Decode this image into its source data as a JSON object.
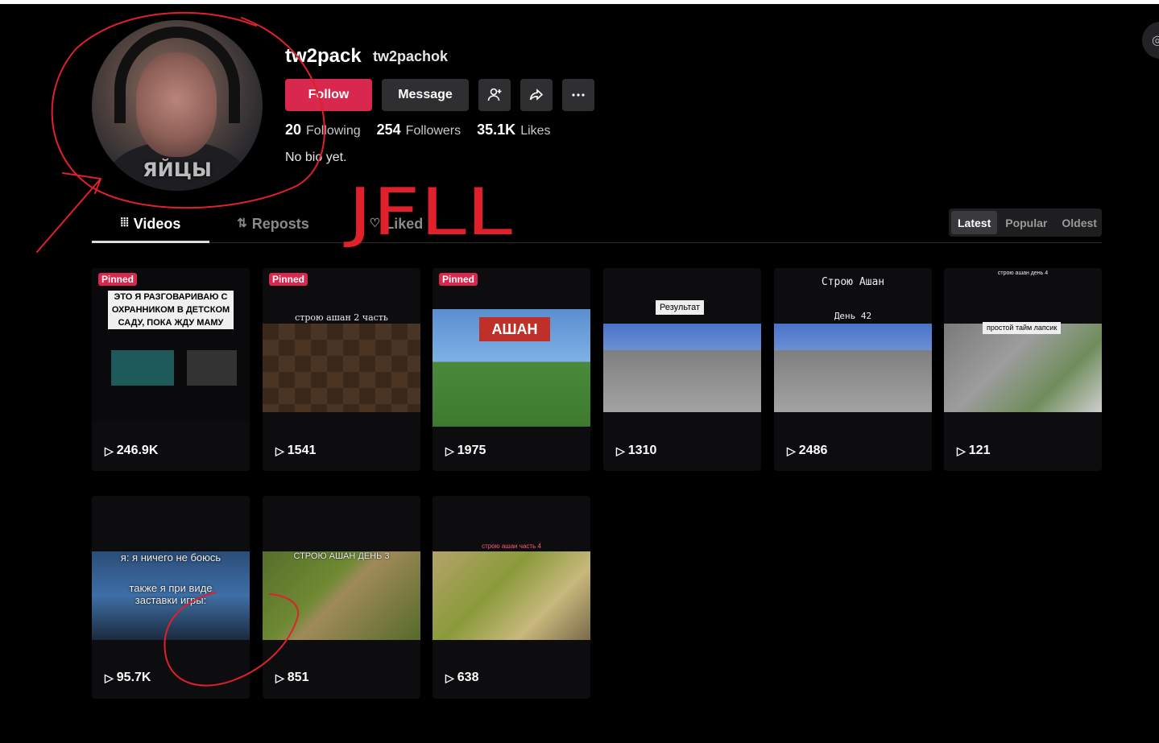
{
  "profile": {
    "username": "tw2pack",
    "handle": "tw2pachok",
    "avatar_caption": "ЯЙЦЫ",
    "bio": "No bio yet.",
    "stats": [
      {
        "value": "20",
        "label": "Following"
      },
      {
        "value": "254",
        "label": "Followers"
      },
      {
        "value": "35.1K",
        "label": "Likes"
      }
    ]
  },
  "actions": {
    "follow": "Follow",
    "message": "Message",
    "add_friend_icon": "add-user-icon",
    "share_icon": "share-icon",
    "more_icon": "more-icon"
  },
  "tabs": [
    {
      "label": "Videos",
      "icon": "grid-icon",
      "active": true
    },
    {
      "label": "Reposts",
      "icon": "repost-icon",
      "active": false
    },
    {
      "label": "Liked",
      "icon": "heart-icon",
      "active": false
    }
  ],
  "sort": {
    "options": [
      "Latest",
      "Popular",
      "Oldest"
    ],
    "selected": "Latest"
  },
  "pinned_label": "Pinned",
  "videos": [
    {
      "views": "246.9K",
      "pinned": true,
      "caption": "ЭТО Я РАЗГОВАРИВАЮ С ОХРАННИКОМ В ДЕТСКОМ САДУ, ПОКА ЖДУ МАМУ"
    },
    {
      "views": "1541",
      "pinned": true,
      "caption": "строю ашан 2 часть"
    },
    {
      "views": "1975",
      "pinned": true,
      "caption": "АШАН"
    },
    {
      "views": "1310",
      "pinned": false,
      "caption": "Результат"
    },
    {
      "views": "2486",
      "pinned": false,
      "caption": "Строю Ашан",
      "caption2": "День 42"
    },
    {
      "views": "121",
      "pinned": false,
      "caption": "строю ашан день 4",
      "caption2": "простой тайм лапсик"
    },
    {
      "views": "95.7K",
      "pinned": false,
      "caption": "я: я ничего не боюсь",
      "caption2": "также я при виде заставки игры:"
    },
    {
      "views": "851",
      "pinned": false,
      "caption": "СТРОЮ АШАН ДЕНЬ 3"
    },
    {
      "views": "638",
      "pinned": false,
      "caption": "строю ашан часть 4"
    }
  ],
  "annotation_text": "JFLL",
  "colors": {
    "accent": "#d8284e",
    "background": "#000000",
    "button": "#2f2f32",
    "scribble": "#e0202a"
  }
}
